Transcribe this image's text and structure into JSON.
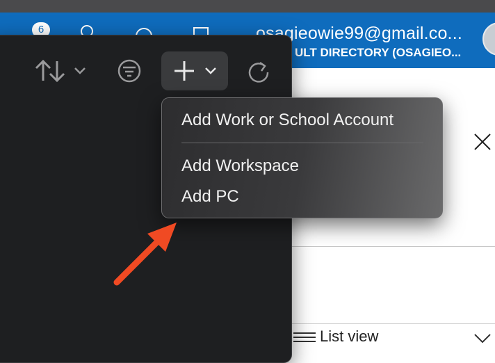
{
  "background_portal": {
    "notification_count": "6",
    "account_email": "osagieowie99@gmail.co...",
    "account_directory": "ULT DIRECTORY (OSAGIEO...",
    "list_view_label": "List view"
  },
  "toolbar": {
    "icons": [
      "sort-icon",
      "filter-icon",
      "add-icon",
      "refresh-icon"
    ]
  },
  "add_menu": {
    "items": [
      "Add Work or School Account",
      "Add Workspace",
      "Add PC"
    ]
  },
  "annotation": {
    "arrow_color": "#f04a23"
  },
  "colors": {
    "portal_blue": "#0f6cbd",
    "app_dark": "#1e1f21"
  }
}
